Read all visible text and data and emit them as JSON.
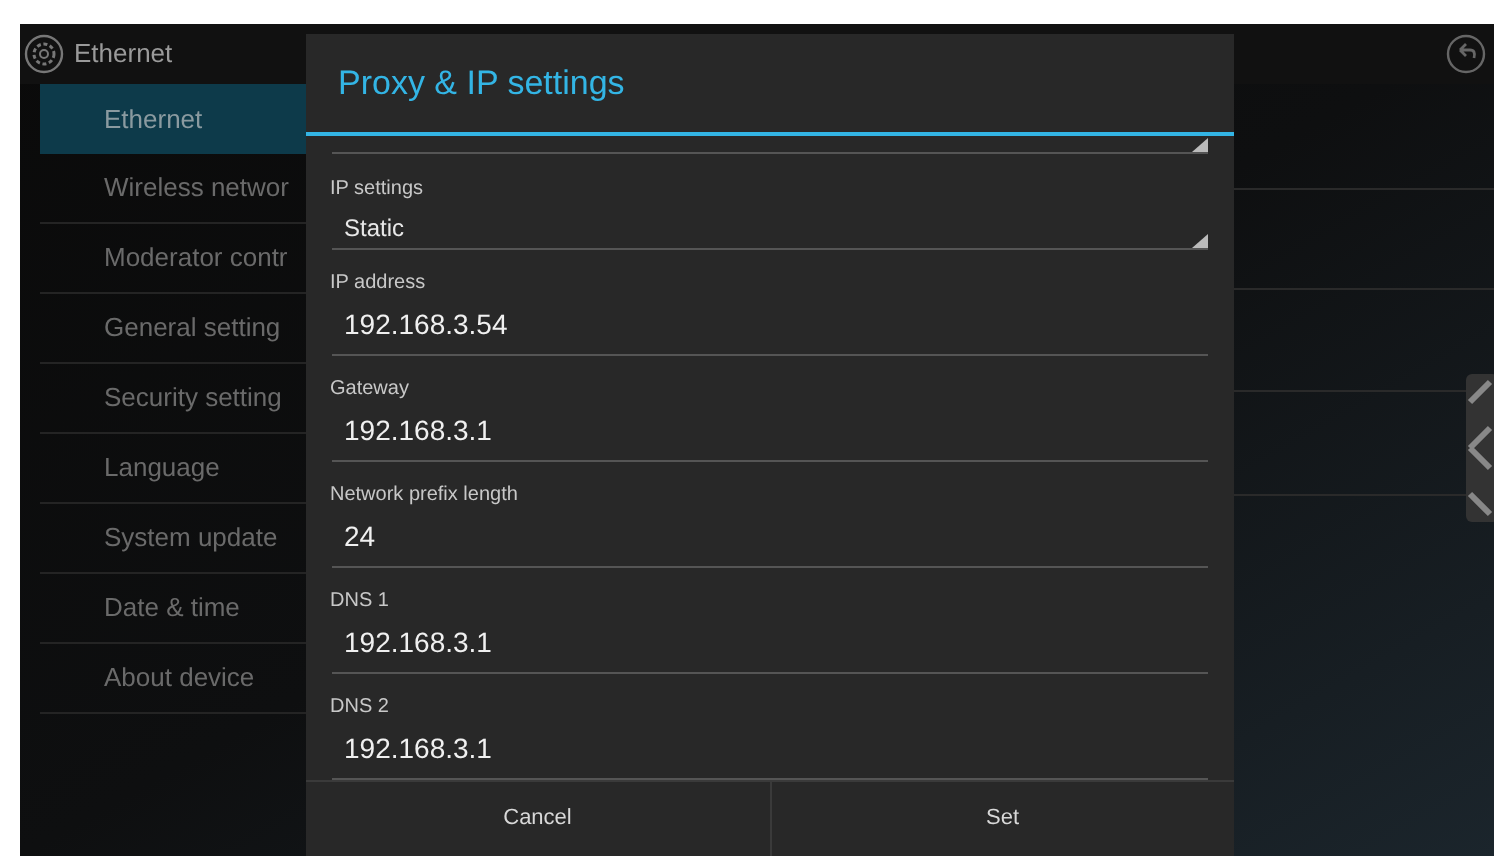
{
  "header": {
    "title": "Ethernet"
  },
  "sidebar": {
    "items": [
      {
        "label": "Ethernet",
        "selected": true
      },
      {
        "label": "Wireless networ",
        "selected": false
      },
      {
        "label": "Moderator contr",
        "selected": false
      },
      {
        "label": "General setting",
        "selected": false
      },
      {
        "label": "Security setting",
        "selected": false
      },
      {
        "label": "Language",
        "selected": false
      },
      {
        "label": "System update",
        "selected": false
      },
      {
        "label": "Date & time",
        "selected": false
      },
      {
        "label": "About device",
        "selected": false
      }
    ]
  },
  "dialog": {
    "title": "Proxy & IP settings",
    "fields": [
      {
        "kind": "spinner",
        "label": "IP settings",
        "value": "Static"
      },
      {
        "kind": "text",
        "label": "IP address",
        "value": "192.168.3.54"
      },
      {
        "kind": "text",
        "label": "Gateway",
        "value": "192.168.3.1"
      },
      {
        "kind": "text",
        "label": "Network prefix length",
        "value": "24"
      },
      {
        "kind": "text",
        "label": "DNS 1",
        "value": "192.168.3.1"
      },
      {
        "kind": "text",
        "label": "DNS 2",
        "value": "192.168.3.1"
      }
    ],
    "buttons": [
      "Cancel",
      "Set"
    ]
  }
}
